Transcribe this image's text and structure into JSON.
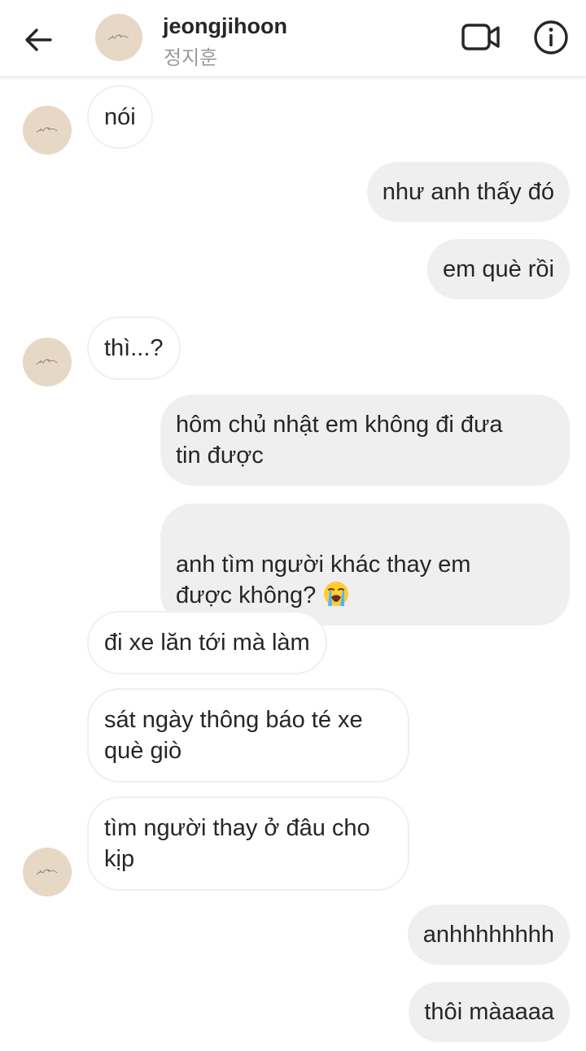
{
  "header": {
    "username": "jeongjihoon",
    "realname": "정지훈",
    "icons": {
      "back": "arrow-left-icon",
      "video": "video-call-icon",
      "info": "info-icon"
    }
  },
  "colors": {
    "outgoing_bubble": "#efefef",
    "incoming_border": "#efefef",
    "avatar_bg": "#e6d8c5",
    "text": "#262626",
    "subtext": "#9a9a9a"
  },
  "messages": [
    {
      "dir": "in",
      "text": "nói"
    },
    {
      "dir": "out",
      "text": "như anh thấy đó"
    },
    {
      "dir": "out",
      "text": "em què rồi"
    },
    {
      "dir": "in",
      "text": "thì...?"
    },
    {
      "dir": "out",
      "text": "hôm chủ nhật em không đi đưa\ntin được"
    },
    {
      "dir": "out",
      "text": "anh tìm người khác thay em\nđược không? ",
      "emoji": "loudly-crying-face-emoji"
    },
    {
      "dir": "in",
      "text": "đi xe lăn tới mà làm"
    },
    {
      "dir": "in",
      "text": "sát ngày thông báo té xe\nquè giò"
    },
    {
      "dir": "in",
      "text": "tìm người thay ở đâu cho\nkịp"
    },
    {
      "dir": "out",
      "text": "anhhhhhhhh"
    },
    {
      "dir": "out",
      "text": "thôi màaaaa"
    }
  ]
}
